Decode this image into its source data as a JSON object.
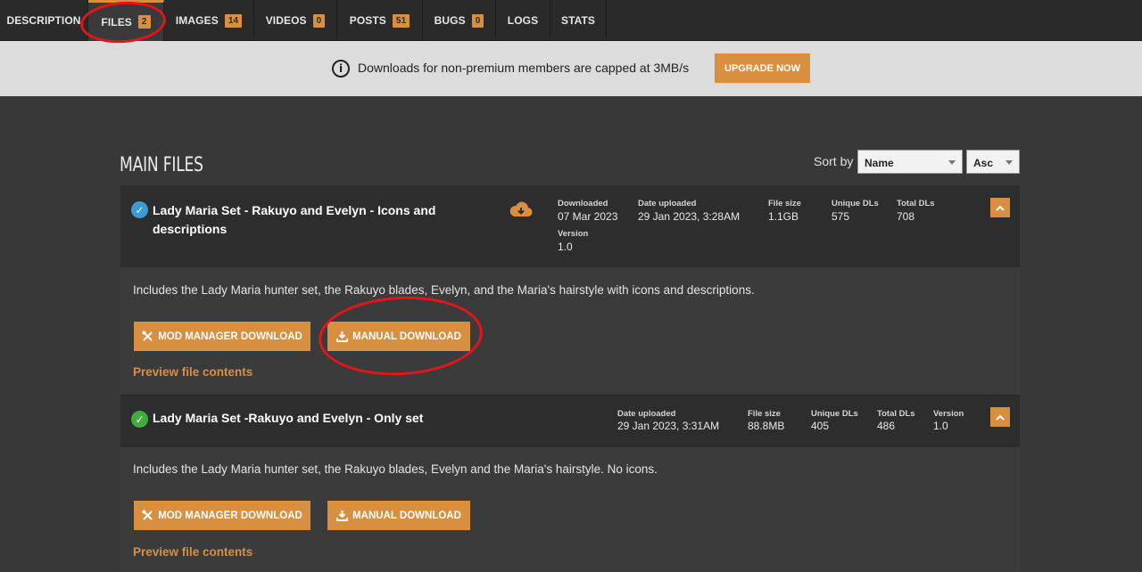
{
  "tabs": [
    {
      "label": "DESCRIPTION",
      "badge": null
    },
    {
      "label": "FILES",
      "badge": "2"
    },
    {
      "label": "IMAGES",
      "badge": "14"
    },
    {
      "label": "VIDEOS",
      "badge": "0"
    },
    {
      "label": "POSTS",
      "badge": "51"
    },
    {
      "label": "BUGS",
      "badge": "0"
    },
    {
      "label": "LOGS",
      "badge": null
    },
    {
      "label": "STATS",
      "badge": null
    }
  ],
  "notice": {
    "text": "Downloads for non-premium members are capped at 3MB/s",
    "upgrade_label": "UPGRADE NOW"
  },
  "main": {
    "heading": "MAIN FILES",
    "sort_label": "Sort by",
    "sort_value": "Name",
    "order_value": "Asc"
  },
  "files": [
    {
      "title_line1": "Lady Maria Set - Rakuyo and Evelyn - Icons and",
      "title_line2": "descriptions",
      "status_color": "#3a9bd9",
      "downloaded_label": "Downloaded",
      "downloaded": "07 Mar 2023",
      "uploaded_label": "Date uploaded",
      "uploaded": "29 Jan 2023, 3:28AM",
      "size_label": "File size",
      "size": "1.1GB",
      "unique_label": "Unique DLs",
      "unique": "575",
      "total_label": "Total DLs",
      "total": "708",
      "version_label": "Version",
      "version": "1.0",
      "description": "Includes the Lady Maria hunter set, the Rakuyo blades, Evelyn, and the Maria's hairstyle with icons and descriptions.",
      "mod_manager_label": "MOD MANAGER DOWNLOAD",
      "manual_label": "MANUAL DOWNLOAD",
      "preview_label": "Preview file contents"
    },
    {
      "title": "Lady Maria Set -Rakuyo and Evelyn - Only set",
      "status_color": "#3fae3c",
      "uploaded_label": "Date uploaded",
      "uploaded": "29 Jan 2023, 3:31AM",
      "size_label": "File size",
      "size": "88.8MB",
      "unique_label": "Unique DLs",
      "unique": "405",
      "total_label": "Total DLs",
      "total": "486",
      "version_label": "Version",
      "version": "1.0",
      "description": "Includes the Lady Maria hunter set, the Rakuyo blades, Evelyn and the Maria's hairstyle. No icons.",
      "mod_manager_label": "MOD MANAGER DOWNLOAD",
      "manual_label": "MANUAL DOWNLOAD",
      "preview_label": "Preview file contents"
    }
  ],
  "colors": {
    "accent": "#d98f40",
    "annotation": "#e3151a"
  }
}
